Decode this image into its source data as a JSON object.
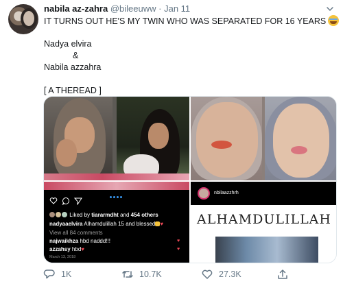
{
  "tweet": {
    "display_name": "nabila az-zahra",
    "handle": "@bileeuww",
    "separator": "·",
    "date": "Jan 11",
    "text_line1": "IT TURNS OUT HE'S MY TWIN WHO WAS SEPARATED FOR 16 YEARS",
    "text_line2": "Nadya elvira",
    "text_line3": "&",
    "text_line4": "Nabila azzahra",
    "text_line5": "[ A THEREAD ]"
  },
  "instagram_dark": {
    "liked_prefix": "Liked by",
    "liked_user": "tiararmdht",
    "liked_and": "and",
    "liked_count": "454 others",
    "caption_user": "nadyaaelvira",
    "caption_text": "Alhamdulillah 15 and blessed",
    "view_comments": "View all 84 comments",
    "comment1_user": "najwaikhza",
    "comment1_text": "hbd naddd!!!",
    "comment2_user": "azzahsy",
    "comment2_text": "hbd",
    "post_date": "March 13, 2018"
  },
  "instagram_white": {
    "username": "nbilaazzhrh",
    "title": "ALHAMDULILLAH"
  },
  "actions": {
    "reply_count": "1K",
    "retweet_count": "10.7K",
    "like_count": "27.3K"
  },
  "icons": {
    "reply": "reply-icon",
    "retweet": "retweet-icon",
    "like": "heart-icon",
    "share": "share-icon",
    "caret": "chevron-down-icon",
    "emoji": "crying-face-emoji"
  },
  "colors": {
    "text": "#14171a",
    "secondary": "#657786",
    "border": "#e1e8ed",
    "ig_like": "#ed4956",
    "ig_link": "#3897f0"
  }
}
